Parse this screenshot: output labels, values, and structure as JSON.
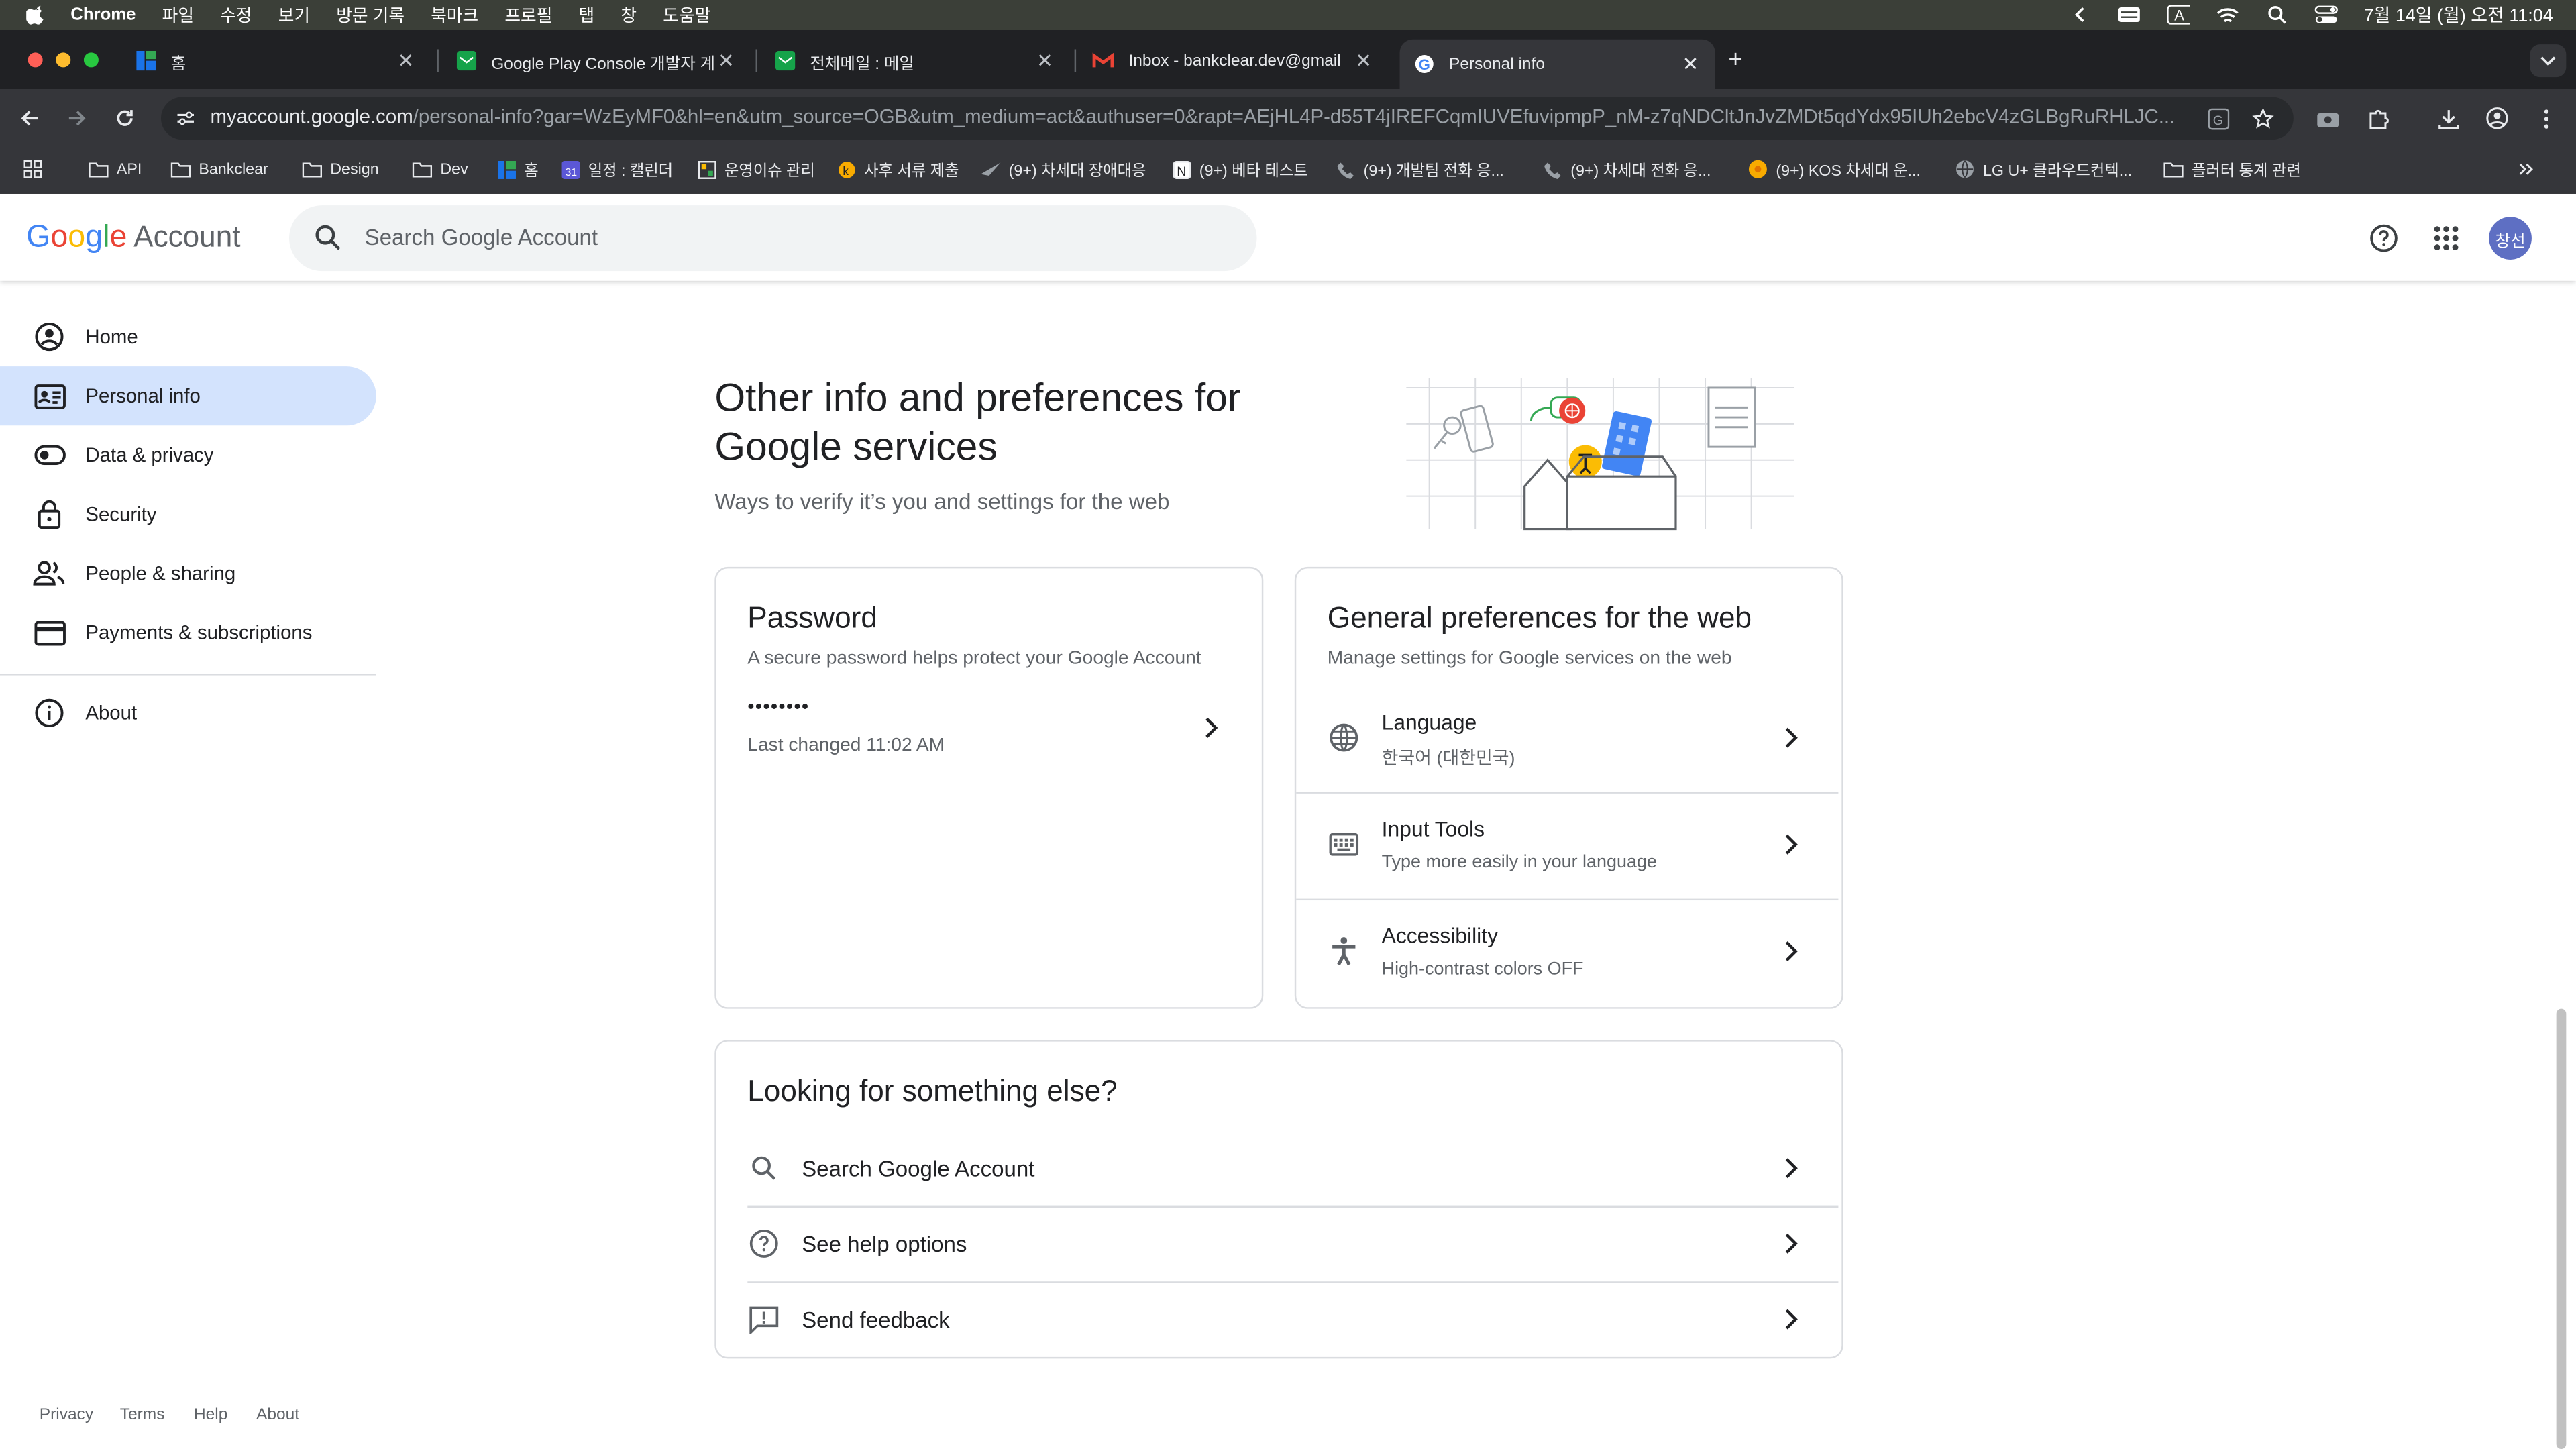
{
  "menubar": {
    "items": [
      "Chrome",
      "파일",
      "수정",
      "보기",
      "방문 기록",
      "북마크",
      "프로필",
      "탭",
      "창",
      "도움말"
    ],
    "clock": "7월 14일 (월) 오전 11:04"
  },
  "tabs": [
    {
      "title": "홈"
    },
    {
      "title": "Google Play Console 개발자 계"
    },
    {
      "title": "전체메일 : 메일"
    },
    {
      "title": "Inbox - bankclear.dev@gmail"
    },
    {
      "title": "Personal info"
    }
  ],
  "toolbar": {
    "url_host": "myaccount.google.com",
    "url_path": "/personal-info?gar=WzEyMF0&hl=en&utm_source=OGB&utm_medium=act&authuser=0&rapt=AEjHL4P-d55T4jIREFCqmIUVEfuvipmpP_nM-z7qNDCltJnJvZMDt5qdYdx95IUh2ebcV4zGLBgRuRHLJC..."
  },
  "bookmarks": [
    "API",
    "Bankclear",
    "Design",
    "Dev",
    "홈",
    "일정 : 캘린더",
    "운영이슈 관리",
    "사후 서류 제출",
    "(9+) 차세대 장애대응",
    "(9+) 베타 테스트",
    "(9+) 개발팀 전화 응...",
    "(9+) 차세대 전화 응...",
    "(9+) KOS 차세대 운...",
    "LG U+ 클라우드컨텍...",
    "플러터 통계 관련"
  ],
  "header": {
    "logo_word": "Google",
    "logo_suffix": "Account",
    "search_placeholder": "Search Google Account",
    "avatar_text": "창선"
  },
  "sidebar": {
    "items": [
      {
        "label": "Home"
      },
      {
        "label": "Personal info"
      },
      {
        "label": "Data & privacy"
      },
      {
        "label": "Security"
      },
      {
        "label": "People & sharing"
      },
      {
        "label": "Payments & subscriptions"
      },
      {
        "label": "About"
      }
    ],
    "footer": [
      "Privacy",
      "Terms",
      "Help",
      "About"
    ]
  },
  "main": {
    "title": "Other info and preferences for Google services",
    "subtitle": "Ways to verify it’s you and settings for the web",
    "password_card": {
      "title": "Password",
      "desc": "A secure password helps protect your Google Account",
      "masked": "••••••••",
      "changed": "Last changed 11:02 AM"
    },
    "prefs_card": {
      "title": "General preferences for the web",
      "desc": "Manage settings for Google services on the web",
      "rows": [
        {
          "title": "Language",
          "sub": "한국어 (대한민국)"
        },
        {
          "title": "Input Tools",
          "sub": "Type more easily in your language"
        },
        {
          "title": "Accessibility",
          "sub": "High-contrast colors OFF"
        }
      ]
    },
    "else_card": {
      "title": "Looking for something else?",
      "rows": [
        {
          "label": "Search Google Account"
        },
        {
          "label": "See help options"
        },
        {
          "label": "Send feedback"
        }
      ]
    }
  }
}
